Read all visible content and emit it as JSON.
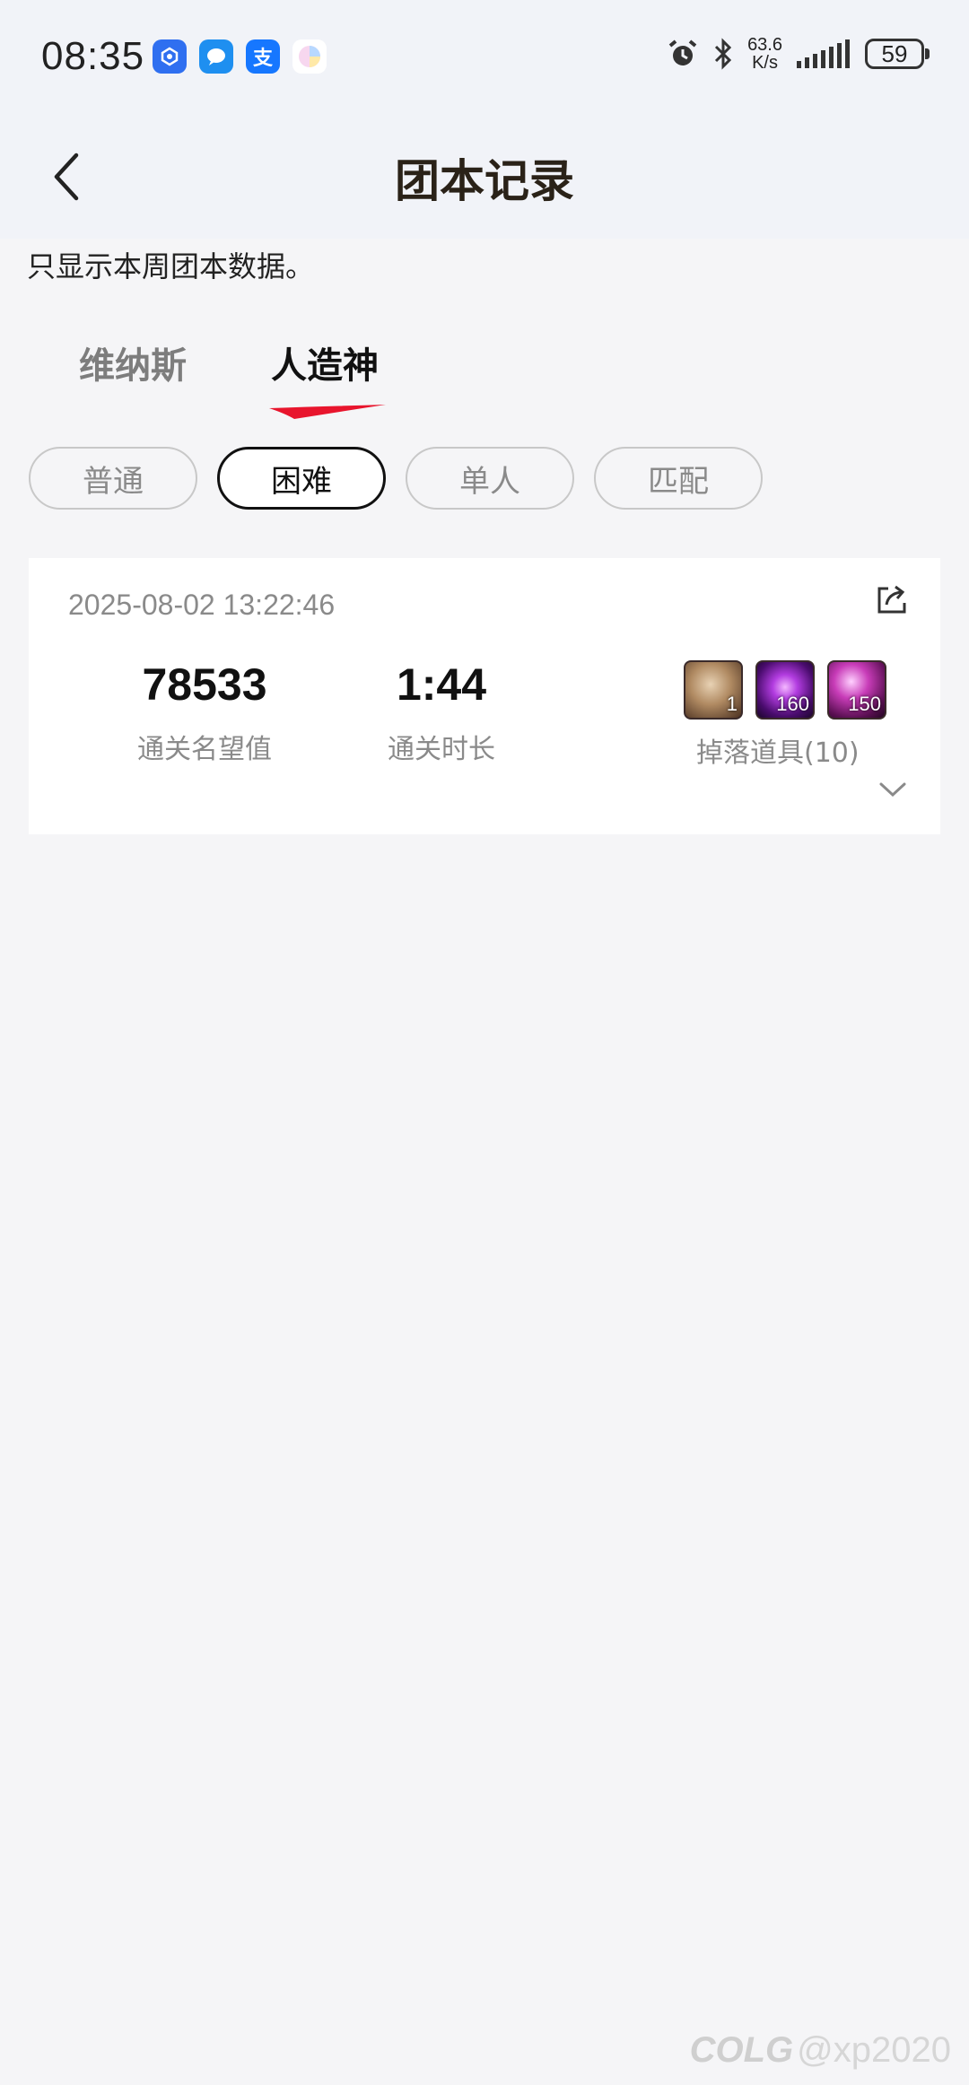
{
  "status_bar": {
    "time": "08:35",
    "apps": [
      {
        "icon": "app-blue-icon",
        "color": "#2f6ff0",
        "glyph": "◍"
      },
      {
        "icon": "chat-icon",
        "color": "#1e8ff0",
        "glyph": "●"
      },
      {
        "icon": "alipay-icon",
        "color": "#1677ff",
        "glyph": "支"
      },
      {
        "icon": "color-ball-icon",
        "color": "#f1f3f8",
        "glyph": "◐"
      }
    ],
    "net_speed_value": "63.6",
    "net_speed_unit": "K/s",
    "battery": "59"
  },
  "header": {
    "title": "团本记录"
  },
  "notice": "只显示本周团本数据。",
  "tabs": {
    "items": [
      "维纳斯",
      "人造神"
    ],
    "active": "人造神"
  },
  "filters": {
    "chips": [
      "普通",
      "困难",
      "单人",
      "匹配"
    ],
    "selected": "困难"
  },
  "record": {
    "datetime": "2025-08-02 13:22:46",
    "reputation_value": "78533",
    "reputation_label": "通关名望值",
    "duration_value": "1:44",
    "duration_label": "通关时长",
    "drops_label": "掉落道具(10)",
    "drop_items": [
      {
        "name": "cloth-bag-item-icon",
        "count": "1",
        "color": "#8a6a4a"
      },
      {
        "name": "purple-orb-item-icon",
        "count": "160",
        "color": "#5a1a8a"
      },
      {
        "name": "purple-crystal-item-icon",
        "count": "150",
        "color": "#7a1a6a"
      }
    ]
  },
  "watermark": {
    "brand": "COLG",
    "handle": "@xp2020"
  },
  "colors": {
    "accent_red": "#e8152d",
    "header_bg": "#f1f3f8",
    "page_bg": "#f5f5f7"
  }
}
